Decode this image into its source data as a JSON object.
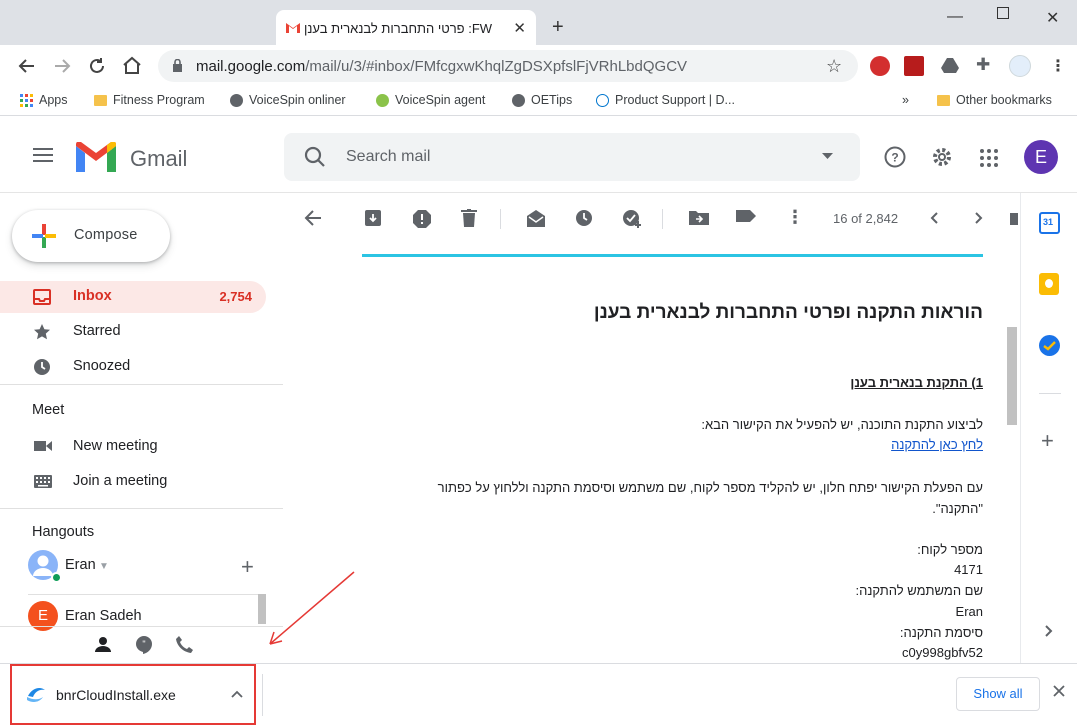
{
  "browser": {
    "tab_title": "FW: פרטי התחברות לבנארית בענן",
    "tab_close": "✕",
    "new_tab": "+",
    "url_host": "mail.google.com",
    "url_path": "/mail/u/3/#inbox/FMfcgxwKhqlZgDSXpfslFjVRhLbdQGCV",
    "bookmarks": [
      "Apps",
      "Fitness Program",
      "VoiceSpin onliner",
      "VoiceSpin agent",
      "OETips",
      "Product Support | D...",
      "»",
      "Other bookmarks"
    ]
  },
  "gmail": {
    "logo_text": "Gmail",
    "search_placeholder": "Search mail",
    "avatar_letter": "E",
    "compose_label": "Compose",
    "nav": [
      {
        "label": "Inbox",
        "count": "2,754"
      },
      {
        "label": "Starred"
      },
      {
        "label": "Snoozed"
      }
    ],
    "meet_heading": "Meet",
    "meet_items": [
      "New meeting",
      "Join a meeting"
    ],
    "hangouts_heading": "Hangouts",
    "hangouts_user": "Eran",
    "hangouts_contact": "Eran Sadeh",
    "hangouts_contact_initial": "E",
    "page_count": "16 of 2,842",
    "calendar_day": "31"
  },
  "message": {
    "title": "הוראות התקנה ופרטי התחברות לבנארית בענן",
    "section1": "1) התקנת בנארית בענן",
    "line1": "לביצוע התקנת התוכנה, יש להפעיל את הקישור הבא:",
    "link1": "לחץ כאן להתקנה",
    "line2": "עם הפעלת הקישור יפתח חלון, יש להקליד מספר לקוח, שם משתמש וסיסמת התקנה וללחוץ על כפתור",
    "line2b": "\"התקנה\".",
    "customer_label": "מספר לקוח:",
    "customer_value": "4171",
    "user_label": "שם המשתמש להתקנה:",
    "user_value": "Eran",
    "password_label": "סיסמת התקנה:",
    "password_value": "c0y998gbfv52"
  },
  "download": {
    "filename": "bnrCloudInstall.exe",
    "show_all": "Show all"
  },
  "colors": {
    "inbox_bg": "#fce8e6",
    "inbox_text": "#d93025",
    "avatar": "#5e35b1",
    "accent_cyan": "#2bc4e3",
    "highlight_red": "#e53935"
  }
}
